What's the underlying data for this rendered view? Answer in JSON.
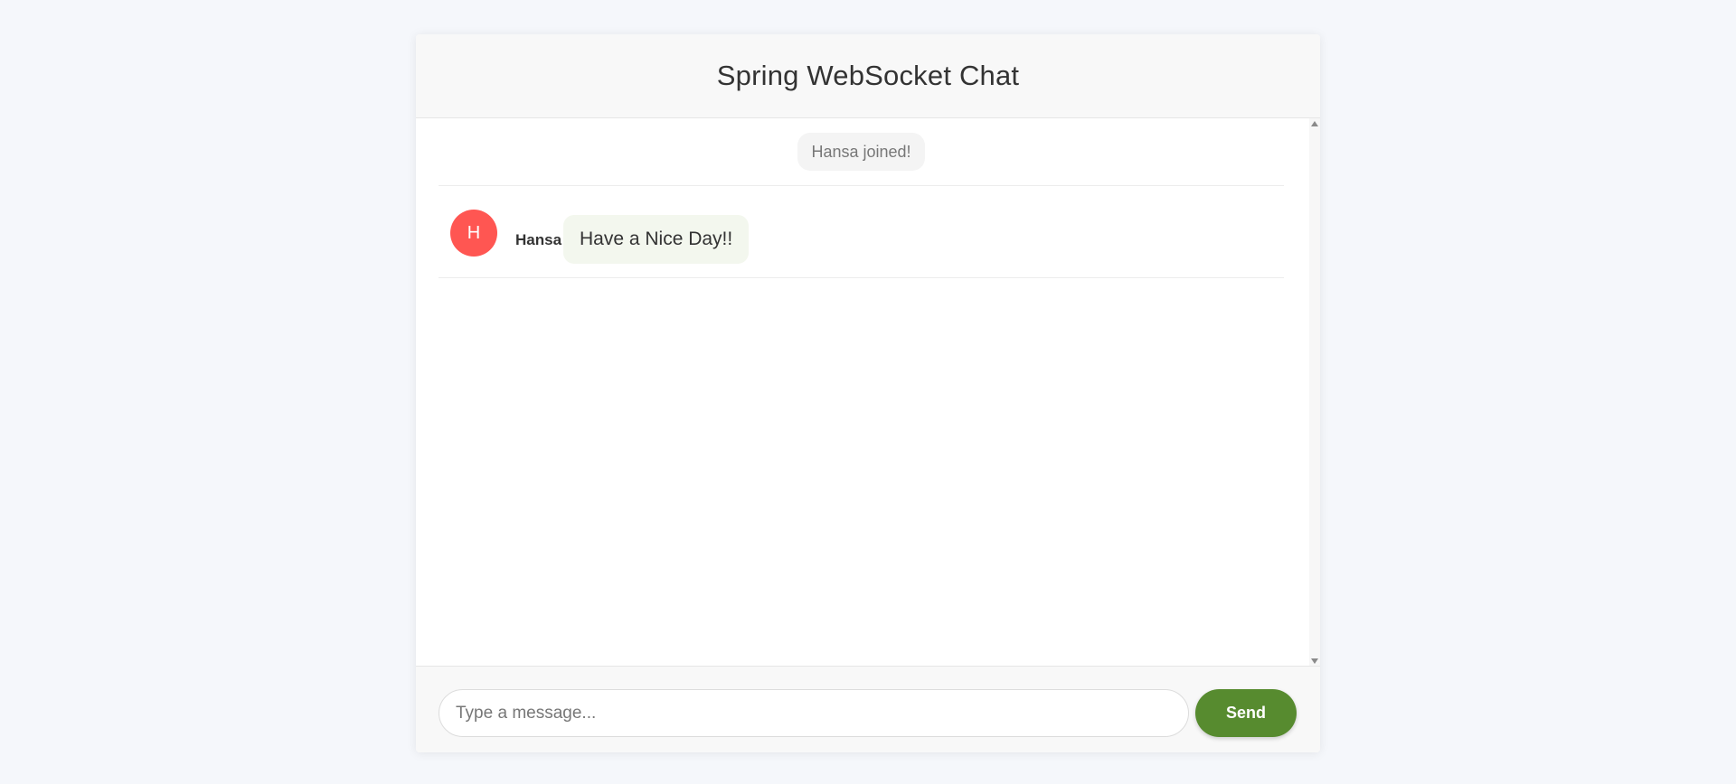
{
  "header": {
    "title": "Spring WebSocket Chat"
  },
  "messages": [
    {
      "type": "event",
      "text": "Hansa joined!"
    },
    {
      "type": "chat",
      "avatar_letter": "H",
      "avatar_color": "#ff5652",
      "sender": "Hansa",
      "text": "Have a Nice Day!!"
    }
  ],
  "composer": {
    "placeholder": "Type a message...",
    "value": "",
    "send_label": "Send"
  },
  "colors": {
    "accent": "#578b2f",
    "page_background": "#f5f7fb",
    "bubble_background": "#f3f7ee"
  }
}
